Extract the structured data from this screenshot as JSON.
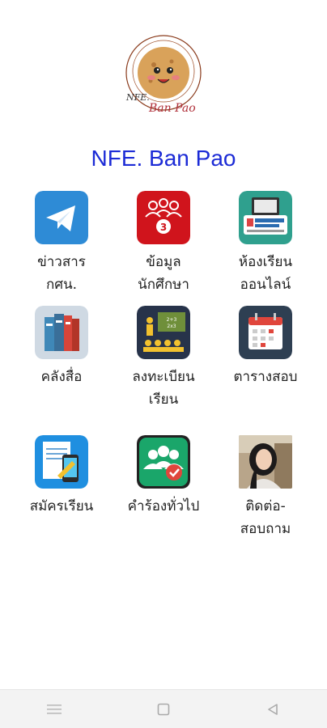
{
  "header": {
    "logo_text_1": "NFE.",
    "logo_text_2": "Ban Pao",
    "title": "NFE. Ban Pao"
  },
  "menu": [
    {
      "label": "ข่าวสาร\nกศน.",
      "icon": "telegram-icon"
    },
    {
      "label": "ข้อมูล\nนักศึกษา",
      "icon": "students-icon"
    },
    {
      "label": "ห้องเรียน\nออนไลน์",
      "icon": "online-classroom-icon"
    },
    {
      "label": "คลังสื่อ",
      "icon": "books-icon"
    },
    {
      "label": "ลงทะเบียน\nเรียน",
      "icon": "classroom-register-icon"
    },
    {
      "label": "ตารางสอบ",
      "icon": "calendar-icon"
    },
    {
      "label": "สมัครเรียน",
      "icon": "application-form-icon"
    },
    {
      "label": "คำร้องทั่วไป",
      "icon": "group-check-icon"
    },
    {
      "label": "ติดต่อ-\nสอบถาม",
      "icon": "contact-photo"
    }
  ],
  "colors": {
    "title": "#1c2bd6",
    "telegram": "#2e8bd6",
    "students": "#d0141c",
    "online": "#2fa08e",
    "books": "#cfd9e3",
    "classroom": "#27334a",
    "calendar": "#2e3f52",
    "form": "#1f8fe0",
    "group": "#1aa66a"
  }
}
